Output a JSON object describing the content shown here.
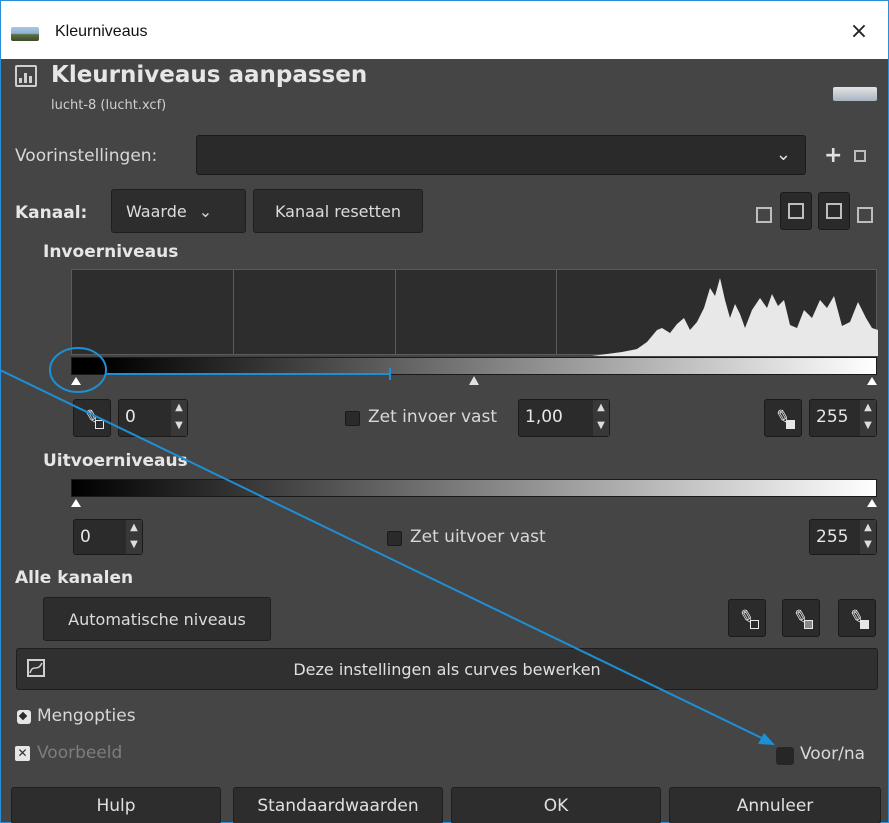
{
  "window": {
    "title": "Kleurniveaus",
    "close_glyph": "×"
  },
  "header": {
    "title": "Kleurniveaus aanpassen",
    "subtitle": "lucht-8 (lucht.xcf)"
  },
  "presets": {
    "label": "Voorinstellingen:",
    "value": "",
    "add_glyph": "+"
  },
  "channel": {
    "label": "Kanaal:",
    "selected": "Waarde",
    "chevron": "⌄",
    "reset_label": "Kanaal resetten"
  },
  "input_levels": {
    "heading": "Invoerniveaus",
    "low_value": "0",
    "gamma_lock_label": "Zet invoer vast",
    "gamma_value": "1,00",
    "high_value": "255"
  },
  "output_levels": {
    "heading": "Uitvoerniveaus",
    "low_value": "0",
    "lock_label": "Zet uitvoer vast",
    "high_value": "255"
  },
  "all_channels": {
    "heading": "Alle kanalen",
    "auto_label": "Automatische niveaus"
  },
  "curves_label": "Deze instellingen als curves bewerken",
  "blend_options_label": "Mengopties",
  "preview_label": "Voorbeeld",
  "before_after_label": "Voor/na",
  "buttons": {
    "help": "Hulp",
    "defaults": "Standaardwaarden",
    "ok": "OK",
    "cancel": "Annuleer"
  },
  "colors": {
    "accent": "#1f8fd4",
    "window_bg": "#454545",
    "widget_bg": "#2b2b2b"
  },
  "icons": [
    "histogram-icon",
    "eyedropper-icon",
    "curves-icon",
    "close-icon",
    "chevron-down-icon"
  ]
}
